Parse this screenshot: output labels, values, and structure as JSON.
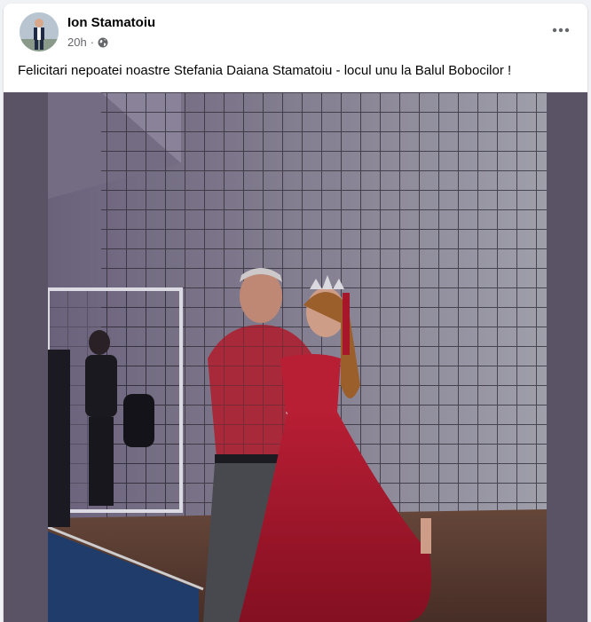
{
  "post": {
    "author_name": "Ion Stamatoiu",
    "timestamp": "20h",
    "separator": "·",
    "privacy_icon": "globe-icon",
    "more_icon": "more-options-icon",
    "message": "Felicitari nepoatei noastre Stefania Daiana Stamatoiu - locul unu la Balul Bobocilor !"
  },
  "colors": {
    "card_background": "#ffffff",
    "page_background": "#f0f2f5",
    "primary_text": "#050505",
    "secondary_text": "#65676b",
    "photo_letterbox": "#5a5265"
  }
}
